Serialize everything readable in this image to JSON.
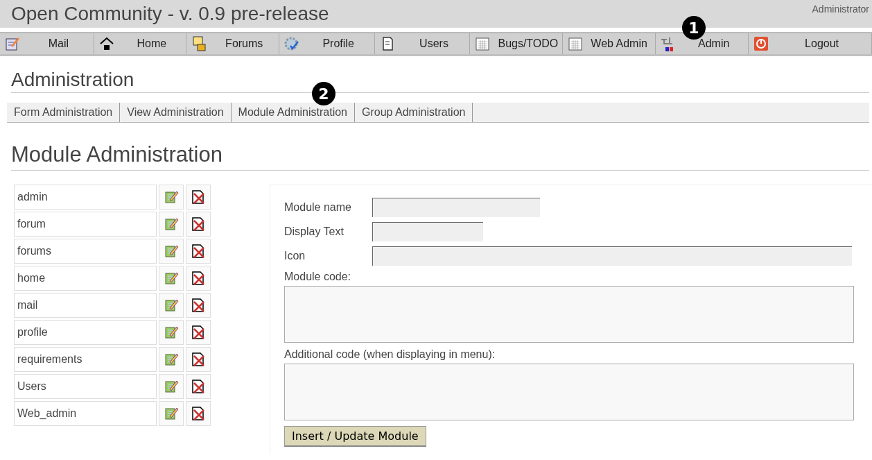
{
  "header": {
    "title": "Open Community - v. 0.9 pre-release",
    "user": "Administrator"
  },
  "menu": [
    {
      "label": "Mail"
    },
    {
      "label": "Home"
    },
    {
      "label": "Forums"
    },
    {
      "label": "Profile"
    },
    {
      "label": "Users"
    },
    {
      "label": "Bugs/TODO"
    },
    {
      "label": "Web Admin"
    },
    {
      "label": "Admin"
    },
    {
      "label": "Logout"
    }
  ],
  "page_title": "Administration",
  "tabs": [
    {
      "label": "Form Administration"
    },
    {
      "label": "View Administration"
    },
    {
      "label": "Module Administration"
    },
    {
      "label": "Group Administration"
    }
  ],
  "section_title": "Module Administration",
  "modules": [
    {
      "name": "admin"
    },
    {
      "name": "forum"
    },
    {
      "name": "forums"
    },
    {
      "name": "home"
    },
    {
      "name": "mail"
    },
    {
      "name": "profile"
    },
    {
      "name": "requirements"
    },
    {
      "name": "Users"
    },
    {
      "name": "Web_admin"
    }
  ],
  "form": {
    "fields": [
      {
        "label": "Module name"
      },
      {
        "label": "Display Text"
      },
      {
        "label": "Icon"
      }
    ],
    "areas": [
      {
        "label": "Module code:"
      },
      {
        "label": "Additional code (when displaying in menu):"
      }
    ],
    "submit": "Insert / Update Module"
  },
  "callouts": [
    {
      "number": "1"
    },
    {
      "number": "2"
    }
  ]
}
